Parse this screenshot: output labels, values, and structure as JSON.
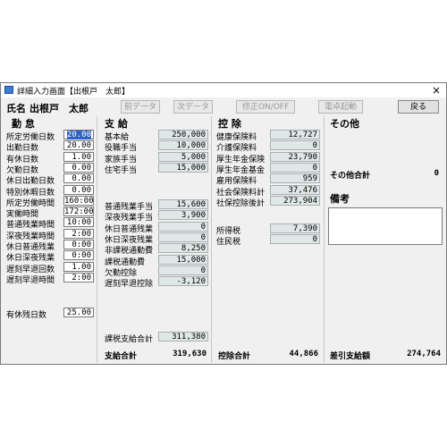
{
  "window": {
    "title": "詳細入力画面【出根戸　太郎】",
    "close": "×"
  },
  "employee": {
    "label": "氏名",
    "name": "出根戸　太郎"
  },
  "toolbar": {
    "prev": "前データ",
    "next": "次データ",
    "edit": "修正ON/OFF",
    "calc": "電卓起動",
    "back": "戻る"
  },
  "attendance": {
    "title": "勤 怠",
    "rows": [
      {
        "label": "所定労働日数",
        "value": "20.00"
      },
      {
        "label": "出勤日数",
        "value": "20.00"
      },
      {
        "label": "有休日数",
        "value": "1.00"
      },
      {
        "label": "欠勤日数",
        "value": "0.00"
      },
      {
        "label": "休日出勤日数",
        "value": "0.00"
      },
      {
        "label": "特別休暇日数",
        "value": "0.00"
      },
      {
        "label": "所定労働時間",
        "value": "160:00"
      },
      {
        "label": "実働時間",
        "value": "172:00"
      },
      {
        "label": "普通残業時間",
        "value": "10:00"
      },
      {
        "label": "深夜残業時間",
        "value": "2:00"
      },
      {
        "label": "休日普通残業",
        "value": "0:00"
      },
      {
        "label": "休日深夜残業",
        "value": "0:00"
      },
      {
        "label": "遅刻早退回数",
        "value": "1.00"
      },
      {
        "label": "遅刻早退時間",
        "value": "2:00"
      }
    ],
    "paid_leave_label": "有休残日数",
    "paid_leave_value": "25.00"
  },
  "payments": {
    "title": "支 給",
    "rows_top": [
      {
        "label": "基本給",
        "value": "250,000"
      },
      {
        "label": "役職手当",
        "value": "10,000"
      },
      {
        "label": "家族手当",
        "value": "5,000"
      },
      {
        "label": "住宅手当",
        "value": "15,000"
      }
    ],
    "rows_bottom": [
      {
        "label": "普通残業手当",
        "value": "15,600"
      },
      {
        "label": "深夜残業手当",
        "value": "3,900"
      },
      {
        "label": "休日普通残業",
        "value": "0"
      },
      {
        "label": "休日深夜残業",
        "value": "0"
      },
      {
        "label": "非課税通勤費",
        "value": "8,250"
      },
      {
        "label": "課税通勤費",
        "value": "15,000"
      },
      {
        "label": "欠勤控除",
        "value": "0"
      },
      {
        "label": "遅刻早退控除",
        "value": "-3,120"
      }
    ],
    "taxable_label": "課税支給合計",
    "taxable_value": "311,380",
    "total_label": "支給合計",
    "total_value": "319,630"
  },
  "deductions": {
    "title": "控 除",
    "rows_top": [
      {
        "label": "健康保険料",
        "value": "12,727"
      },
      {
        "label": "介護保険料",
        "value": "0"
      },
      {
        "label": "厚生年金保険",
        "value": "23,790"
      },
      {
        "label": "厚生年金基金",
        "value": "0"
      },
      {
        "label": "雇用保険料",
        "value": "959"
      },
      {
        "label": "社会保険料計",
        "value": "37,476"
      },
      {
        "label": "社保控除後計",
        "value": "273,904"
      }
    ],
    "rows_tax": [
      {
        "label": "所得税",
        "value": "7,390"
      },
      {
        "label": "住民税",
        "value": "0"
      }
    ],
    "total_label": "控除合計",
    "total_value": "44,866"
  },
  "other": {
    "title": "その他",
    "total_label": "その他合計",
    "total_value": "0",
    "notes_title": "備考",
    "net_label": "差引支給額",
    "net_value": "274,764"
  }
}
